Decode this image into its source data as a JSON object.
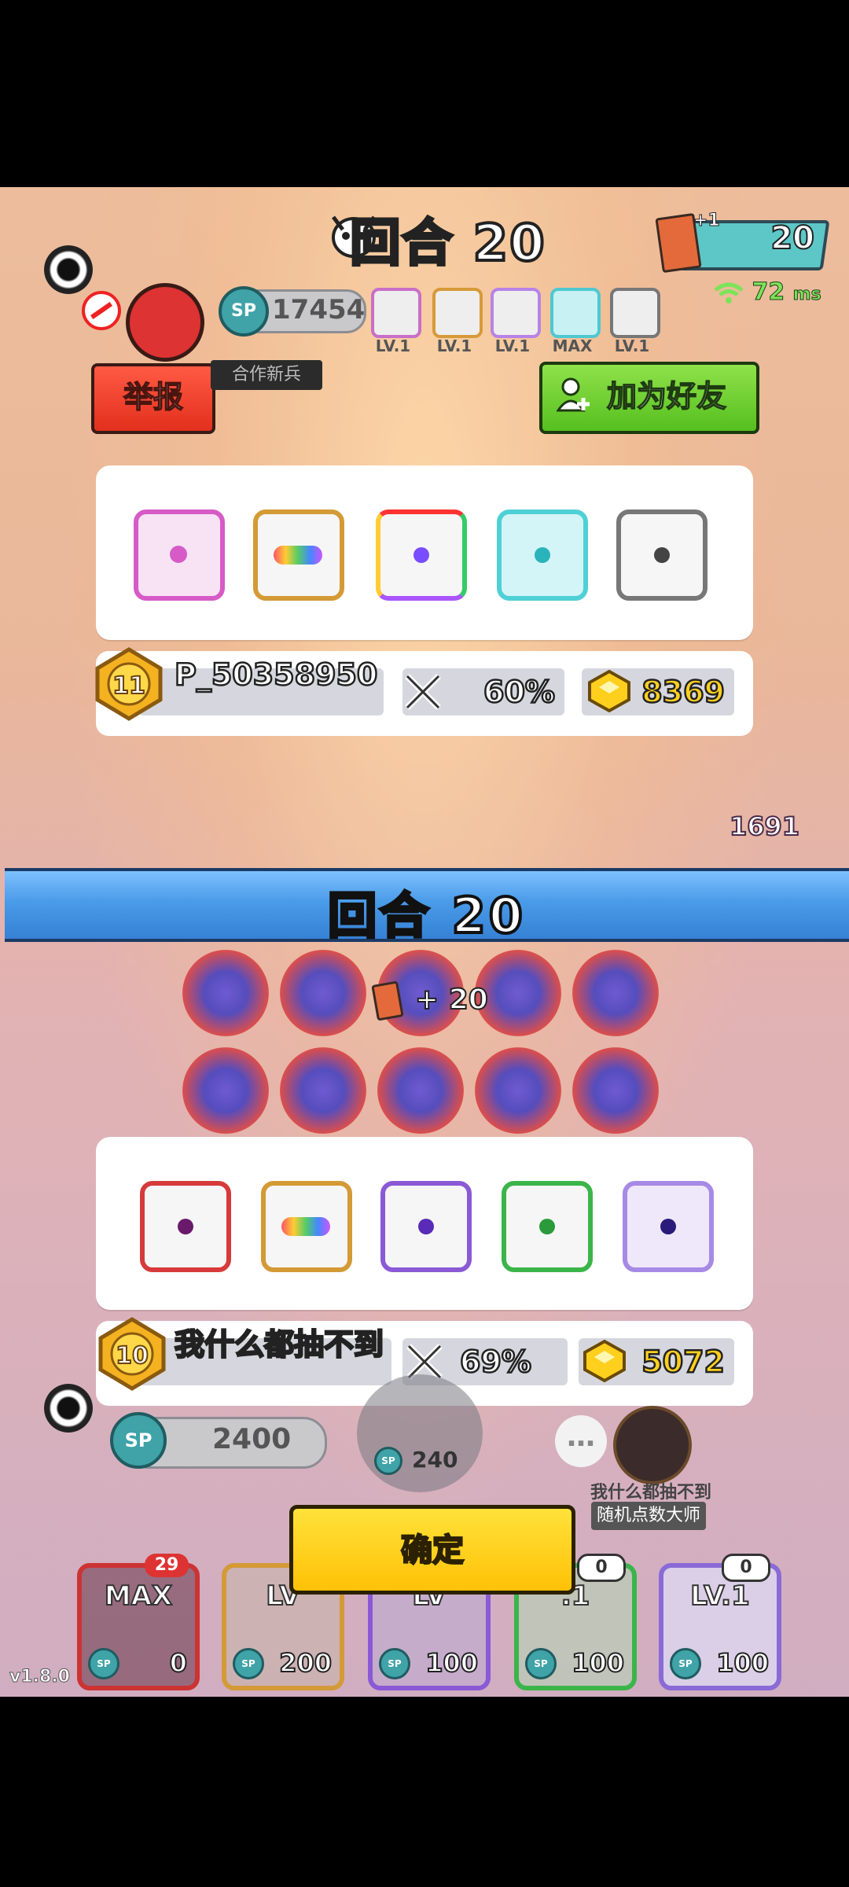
{
  "top_hud": {
    "round_label": "回合 20",
    "card_plus": "+1",
    "card_count": "20",
    "ping_value": "72",
    "ping_unit": "ms"
  },
  "opponent": {
    "sp_label": "SP",
    "sp_value": "17454",
    "mini_dice_levels": [
      "LV.1",
      "LV.1",
      "LV.1",
      "MAX",
      "LV.1"
    ],
    "report_button": "举报",
    "newbie_tag": "合作新兵",
    "add_friend_button": "加为好友",
    "name": "P_50358950",
    "crit_percent": "60%",
    "gold": "8369",
    "badge_level": "11"
  },
  "round_banner": "回合   20",
  "card_reward": "+ 20",
  "egg_count": "1691",
  "player": {
    "name": "我什么都抽不到",
    "crit_percent": "69%",
    "gold": "5072",
    "badge_level": "10",
    "sp_label": "SP",
    "sp_value": "2400",
    "summon_cost": "240",
    "chat_icon": "…",
    "nickname_label": "我什么都抽不到",
    "title_tag": "随机点数大师"
  },
  "confirm_button": "确定",
  "deck": [
    {
      "level": "MAX",
      "cost": "0",
      "tag": "29"
    },
    {
      "level": "LV",
      "cost": "200",
      "tag": ""
    },
    {
      "level": "LV",
      "cost": "100",
      "tag": ""
    },
    {
      "level": ".1",
      "cost": "100",
      "tag": "0"
    },
    {
      "level": "LV.1",
      "cost": "100",
      "tag": "0"
    }
  ],
  "deck_sp_label": "SP",
  "version": "v1.8.0",
  "colors": {
    "report_red": "#e2301d",
    "friend_green": "#56bf1f",
    "banner_blue": "#4a9be8",
    "confirm_yellow": "#ffc107",
    "gold_text": "#ffcf1e"
  }
}
